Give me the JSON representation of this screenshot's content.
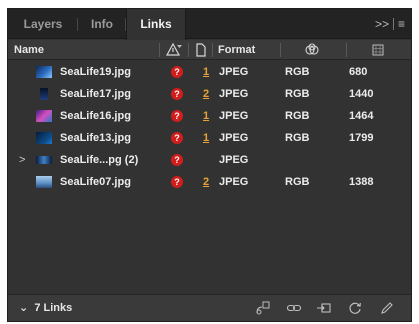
{
  "tabs": [
    {
      "label": "Layers",
      "active": false
    },
    {
      "label": "Info",
      "active": false
    },
    {
      "label": "Links",
      "active": true
    }
  ],
  "panel_menu": {
    "collapse": ">>",
    "menu": "≡"
  },
  "columns": {
    "name": "Name",
    "status_icon": "warning-filter-icon",
    "page_icon": "page-icon",
    "format": "Format",
    "color_icon": "color-space-icon",
    "ppi_icon": "resolution-icon"
  },
  "rows": [
    {
      "name": "SeaLife19.jpg",
      "page": "1",
      "format": "JPEG",
      "color": "RGB",
      "ppi": "680",
      "has_expander": false
    },
    {
      "name": "SeaLife17.jpg",
      "page": "2",
      "format": "JPEG",
      "color": "RGB",
      "ppi": "1440",
      "has_expander": false
    },
    {
      "name": "SeaLife16.jpg",
      "page": "1",
      "format": "JPEG",
      "color": "RGB",
      "ppi": "1464",
      "has_expander": false
    },
    {
      "name": "SeaLife13.jpg",
      "page": "1",
      "format": "JPEG",
      "color": "RGB",
      "ppi": "1799",
      "has_expander": false
    },
    {
      "name": "SeaLife...pg (2)",
      "page": "",
      "format": "JPEG",
      "color": "",
      "ppi": "",
      "has_expander": true
    },
    {
      "name": "SeaLife07.jpg",
      "page": "2",
      "format": "JPEG",
      "color": "RGB",
      "ppi": "1388",
      "has_expander": false
    }
  ],
  "warning_glyph": "?",
  "footer": {
    "count_label": "7 Links",
    "icons": [
      "relink-from-cc-icon",
      "relink-icon",
      "go-to-link-icon",
      "update-link-icon",
      "edit-original-icon"
    ]
  },
  "colors": {
    "panel_bg": "#323232",
    "accent_orange": "#e8a238",
    "warning_red": "#d21d1d"
  }
}
